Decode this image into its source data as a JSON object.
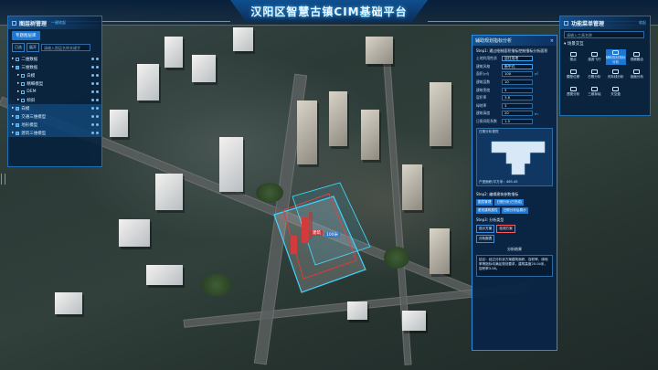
{
  "header": {
    "title": "汉阳区智慧古镇CIM基础平台"
  },
  "left_panel": {
    "title": "图层树管理",
    "collapse_link": "一键收起",
    "topic_button": "专题图层库",
    "toolbar": {
      "label_a": "已选",
      "label_b": "展开",
      "search_placeholder": "请输入图层名称关键字"
    },
    "tree": [
      {
        "label": "二维数据",
        "indent": 0,
        "checked": false,
        "highlight": false
      },
      {
        "label": "三维数据",
        "indent": 0,
        "checked": true,
        "highlight": false
      },
      {
        "label": "白模",
        "indent": 1,
        "checked": false,
        "highlight": false
      },
      {
        "label": "精细模型",
        "indent": 1,
        "checked": false,
        "highlight": false
      },
      {
        "label": "DEM",
        "indent": 1,
        "checked": false,
        "highlight": false
      },
      {
        "label": "倾斜",
        "indent": 1,
        "checked": false,
        "highlight": false
      },
      {
        "label": "白模",
        "indent": 0,
        "checked": true,
        "highlight": true
      },
      {
        "label": "交通三维模型",
        "indent": 0,
        "checked": true,
        "highlight": true
      },
      {
        "label": "地形模型",
        "indent": 0,
        "checked": true,
        "highlight": true
      },
      {
        "label": "建筑三维模型",
        "indent": 0,
        "checked": true,
        "highlight": true
      }
    ]
  },
  "right_panel": {
    "title": "功能菜单管理",
    "link": "收起",
    "search_placeholder": "请输入工具名称",
    "section": "场景交互",
    "tools": [
      "视点",
      "漫游飞行",
      "辅助规划指标分析",
      "视频融合",
      "模型位移",
      "日照分析",
      "天际线分析",
      "剖面分析",
      "透视分析",
      "三维标绘",
      "天空盒"
    ],
    "active_index": 2
  },
  "dialog": {
    "title": "辅助规划指标分析",
    "step1": "Step1: 通过绘制面积指标控制指标分析面积",
    "fields": [
      {
        "label": "土地利用性质",
        "value": "居住用地"
      },
      {
        "label": "建筑风格",
        "value": "新中式"
      },
      {
        "label": "面积(㎡)",
        "value": "100",
        "unit": "㎡"
      },
      {
        "label": "建筑层数",
        "value": "10"
      },
      {
        "label": "建筑密度",
        "value": "5"
      },
      {
        "label": "容积率",
        "value": "3.6"
      },
      {
        "label": "绿地率",
        "value": "3"
      },
      {
        "label": "建筑高度",
        "value": "20",
        "unit": "m"
      },
      {
        "label": "日照间距系数",
        "value": "1.5"
      }
    ],
    "preview_title": "日照分析视觉",
    "preview_footer": "户型面积/平方米：465.45",
    "step2": "Step2: 编辑建筑参数指标",
    "step2_buttons": [
      "图层管理",
      "日照分析(已完成)",
      "更改建筑属性",
      "日照分析后展示"
    ],
    "step3": "Step3: 分析类型",
    "step3_buttons": [
      "设计方案",
      "检测方案",
      "分析报表"
    ],
    "result_title": "分析结果",
    "result_text": "结论：经过分析该方案建筑面积、容积率、绿地率等指标均满足规划要求，建筑高度20.04米，容积率3.06。"
  },
  "map_labels": {
    "a": "建筑",
    "b": "100米"
  }
}
